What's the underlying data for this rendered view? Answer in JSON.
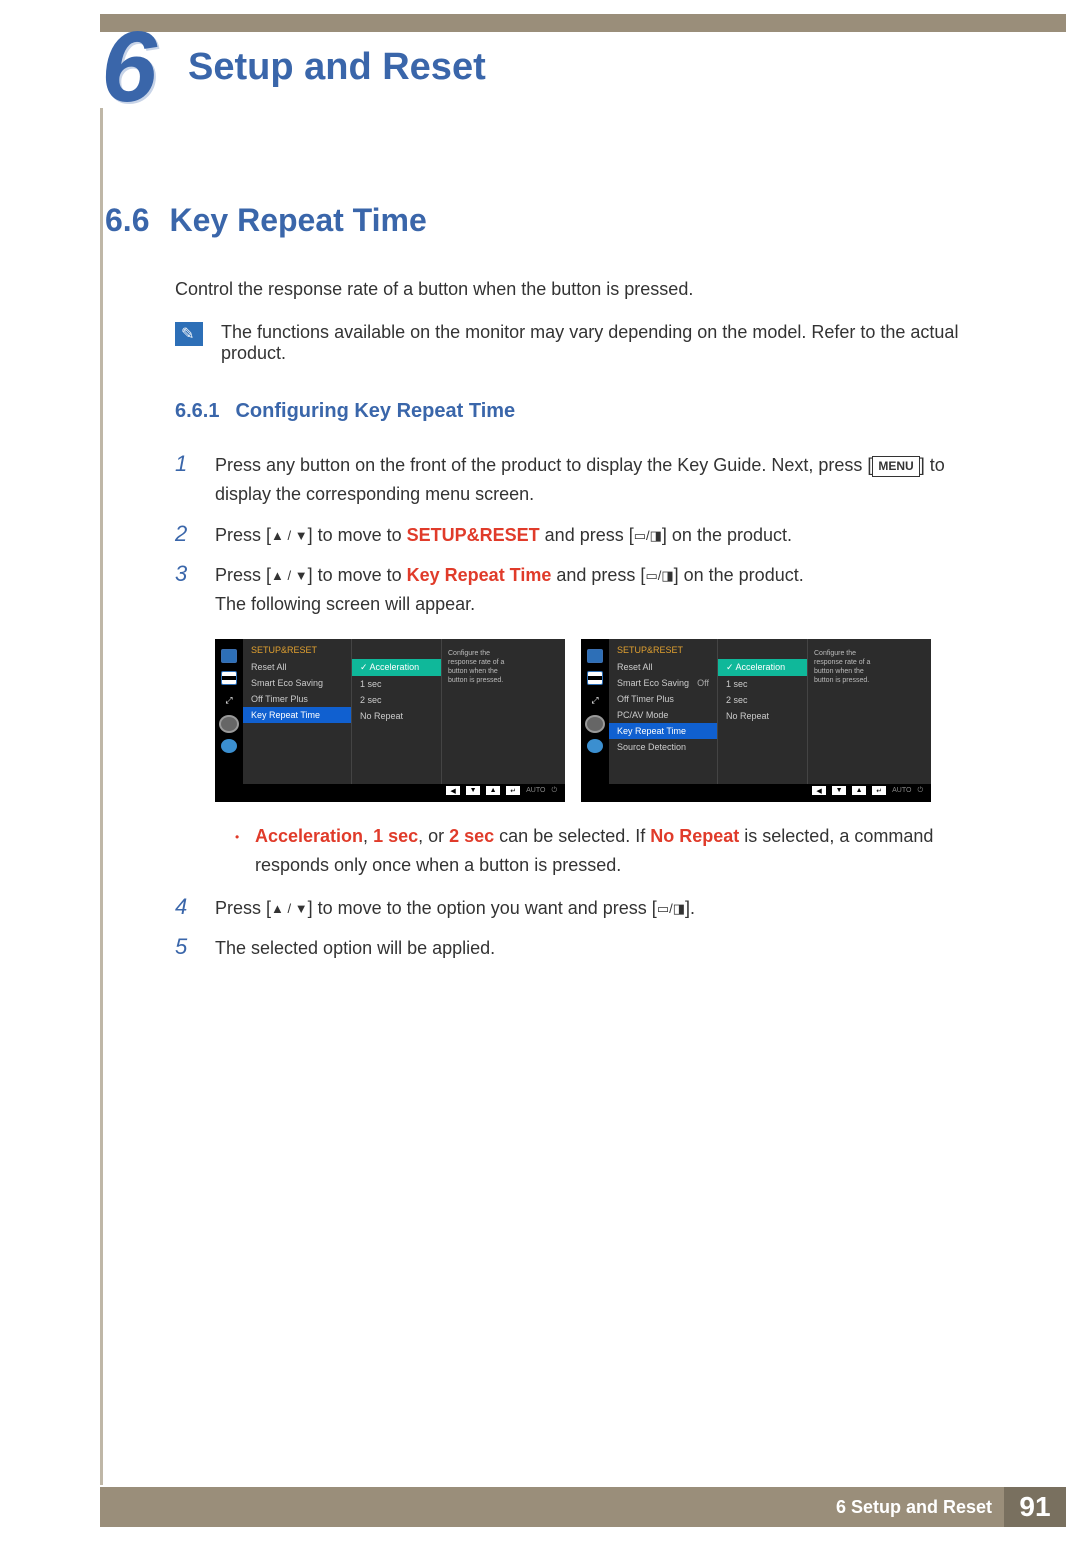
{
  "header": {
    "chapter_number": "6",
    "chapter_title": "Setup and Reset"
  },
  "section": {
    "number": "6.6",
    "title": "Key Repeat Time",
    "intro": "Control the response rate of a button when the button is pressed.",
    "note": "The functions available on the monitor may vary depending on the model. Refer to the actual product."
  },
  "subsection": {
    "number": "6.6.1",
    "title": "Configuring Key Repeat Time"
  },
  "steps": {
    "s1": {
      "num": "1",
      "a": "Press any button on the front of the product to display the Key Guide. Next, press [",
      "b": "MENU",
      "c": "] to display the corresponding menu screen."
    },
    "s2": {
      "num": "2",
      "a": "Press [",
      "b": "] to move to ",
      "c": "SETUP&RESET",
      "d": " and press [",
      "e": "] on the product."
    },
    "s3": {
      "num": "3",
      "a": "Press [",
      "b": "] to move to ",
      "c": "Key Repeat Time",
      "d": " and press [",
      "e": "] on the product.",
      "f": "The following screen will appear."
    },
    "s4": {
      "num": "4",
      "a": "Press [",
      "b": "] to move to the option you want and press [",
      "c": "]."
    },
    "s5": {
      "num": "5",
      "a": "The selected option will be applied."
    }
  },
  "bullet": {
    "a": "Acceleration",
    "b": ", ",
    "c": "1 sec",
    "d": ", or ",
    "e": "2 sec",
    "f": " can be selected. If ",
    "g": "No Repeat",
    "h": " is selected, a command responds only once when a button is pressed."
  },
  "osd": {
    "title": "SETUP&RESET",
    "desc": "Configure the response rate of a button when the button is pressed.",
    "left": {
      "items": [
        "Reset All",
        "Smart Eco Saving",
        "Off Timer Plus",
        "Key Repeat Time"
      ],
      "selected": 3,
      "sub": {
        "selected": 0,
        "options": [
          "Acceleration",
          "1 sec",
          "2 sec",
          "No Repeat"
        ]
      }
    },
    "right": {
      "items": [
        "Reset All",
        "Smart Eco Saving",
        "Off Timer Plus",
        "PC/AV Mode",
        "Key Repeat Time",
        "Source Detection"
      ],
      "values": [
        "",
        "Off",
        "",
        "",
        "",
        ""
      ],
      "selected": 4,
      "sub": {
        "selected": 0,
        "options": [
          "Acceleration",
          "1 sec",
          "2 sec",
          "No Repeat"
        ]
      }
    },
    "foot_auto": "AUTO"
  },
  "footer": {
    "chapter_marker": "6",
    "chapter": "Setup and Reset",
    "page": "91"
  }
}
